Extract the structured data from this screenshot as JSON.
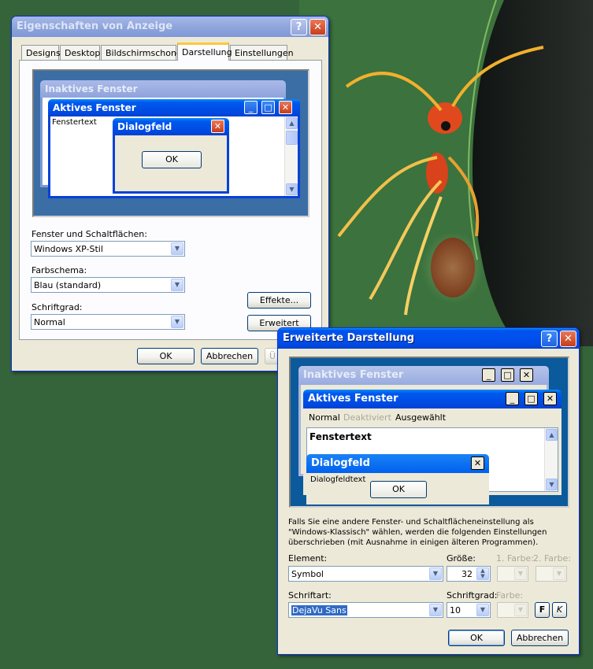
{
  "colors": {
    "xp_blue": "#0054e3",
    "dialog_face": "#ece9d8",
    "desktop_green": "#356234",
    "preview_blue": "#3a6ea5"
  },
  "display_props": {
    "title": "Eigenschaften von Anzeige",
    "tabs": [
      "Designs",
      "Desktop",
      "Bildschirmschoner",
      "Darstellung",
      "Einstellungen"
    ],
    "selected_tab": "Darstellung",
    "preview": {
      "inactive_title": "Inaktives Fenster",
      "active_title": "Aktives Fenster",
      "window_text": "Fenstertext",
      "dialog_title": "Dialogfeld",
      "ok": "OK"
    },
    "windows_buttons_label": "Fenster und Schaltflächen:",
    "windows_buttons_value": "Windows XP-Stil",
    "color_scheme_label": "Farbschema:",
    "color_scheme_value": "Blau (standard)",
    "font_size_label": "Schriftgrad:",
    "font_size_value": "Normal",
    "effects_button": "Effekte...",
    "advanced_button": "Erweitert",
    "ok": "OK",
    "cancel": "Abbrechen",
    "apply_partial": "Ü"
  },
  "advanced": {
    "title": "Erweiterte Darstellung",
    "preview": {
      "inactive_title": "Inaktives Fenster",
      "active_title": "Aktives Fenster",
      "menu": [
        "Normal",
        "Deaktiviert",
        "Ausgewählt"
      ],
      "window_text": "Fenstertext",
      "dialog_title": "Dialogfeld",
      "dialog_text": "Dialogfeldtext",
      "ok": "OK"
    },
    "info_text": "Falls Sie eine andere Fenster- und Schaltflächeneinstellung als \"Windows-Klassisch\" wählen, werden die folgenden Einstellungen überschrieben (mit Ausnahme in einigen älteren Programmen).",
    "element_label": "Element:",
    "element_value": "Symbol",
    "size_label": "Größe:",
    "size_value": "32",
    "color1_label": "1. Farbe:",
    "color2_label": "2. Farbe:",
    "font_label": "Schriftart:",
    "font_value": "DejaVu Sans",
    "font_size_label": "Schriftgrad:",
    "font_size_value": "10",
    "font_color_label": "Farbe:",
    "bold_label": "F",
    "italic_label": "K",
    "ok": "OK",
    "cancel": "Abbrechen"
  }
}
